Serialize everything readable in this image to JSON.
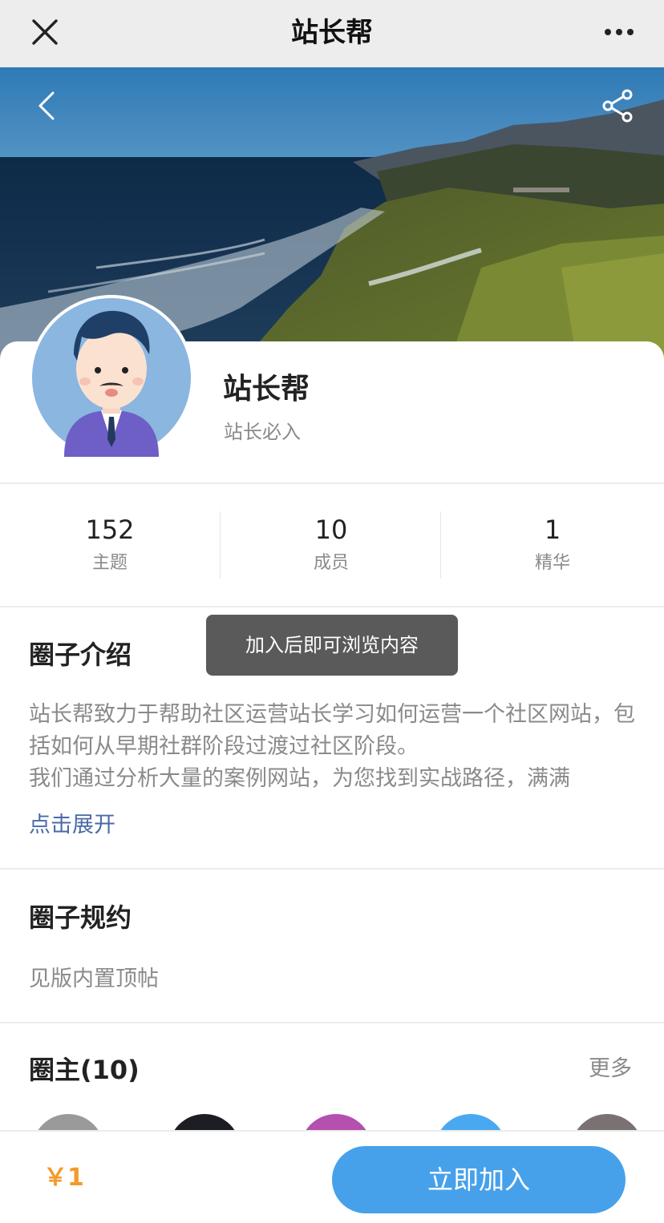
{
  "topbar": {
    "title": "站长帮",
    "close_icon": "close-icon",
    "more_icon": "more-dots-icon"
  },
  "hero": {
    "back_icon": "chevron-left-icon",
    "share_icon": "share-icon"
  },
  "group": {
    "name": "站长帮",
    "subtitle": "站长必入"
  },
  "stats": [
    {
      "value": "152",
      "label": "主题"
    },
    {
      "value": "10",
      "label": "成员"
    },
    {
      "value": "1",
      "label": "精华"
    }
  ],
  "intro": {
    "title": "圈子介绍",
    "text": "站长帮致力于帮助社区运营站长学习如何运营一个社区网站，包括如何从早期社群阶段过渡过社区阶段。\n我们通过分析大量的案例网站，为您找到实战路径，满满",
    "expand_label": "点击展开"
  },
  "rules": {
    "title": "圈子规约",
    "text": "见版内置顶帖"
  },
  "owners": {
    "title": "圈主(10)",
    "more_label": "更多",
    "avatar_colors": [
      "#9a9a9a",
      "#1d1d24",
      "#b54fb0",
      "#4aa8f0",
      "#7a7272"
    ]
  },
  "toast": {
    "text": "加入后即可浏览内容"
  },
  "footer": {
    "price": "￥1",
    "join_label": "立即加入"
  },
  "colors": {
    "accent": "#46a1ea",
    "price": "#f39a2b",
    "link": "#4a6aa8"
  }
}
